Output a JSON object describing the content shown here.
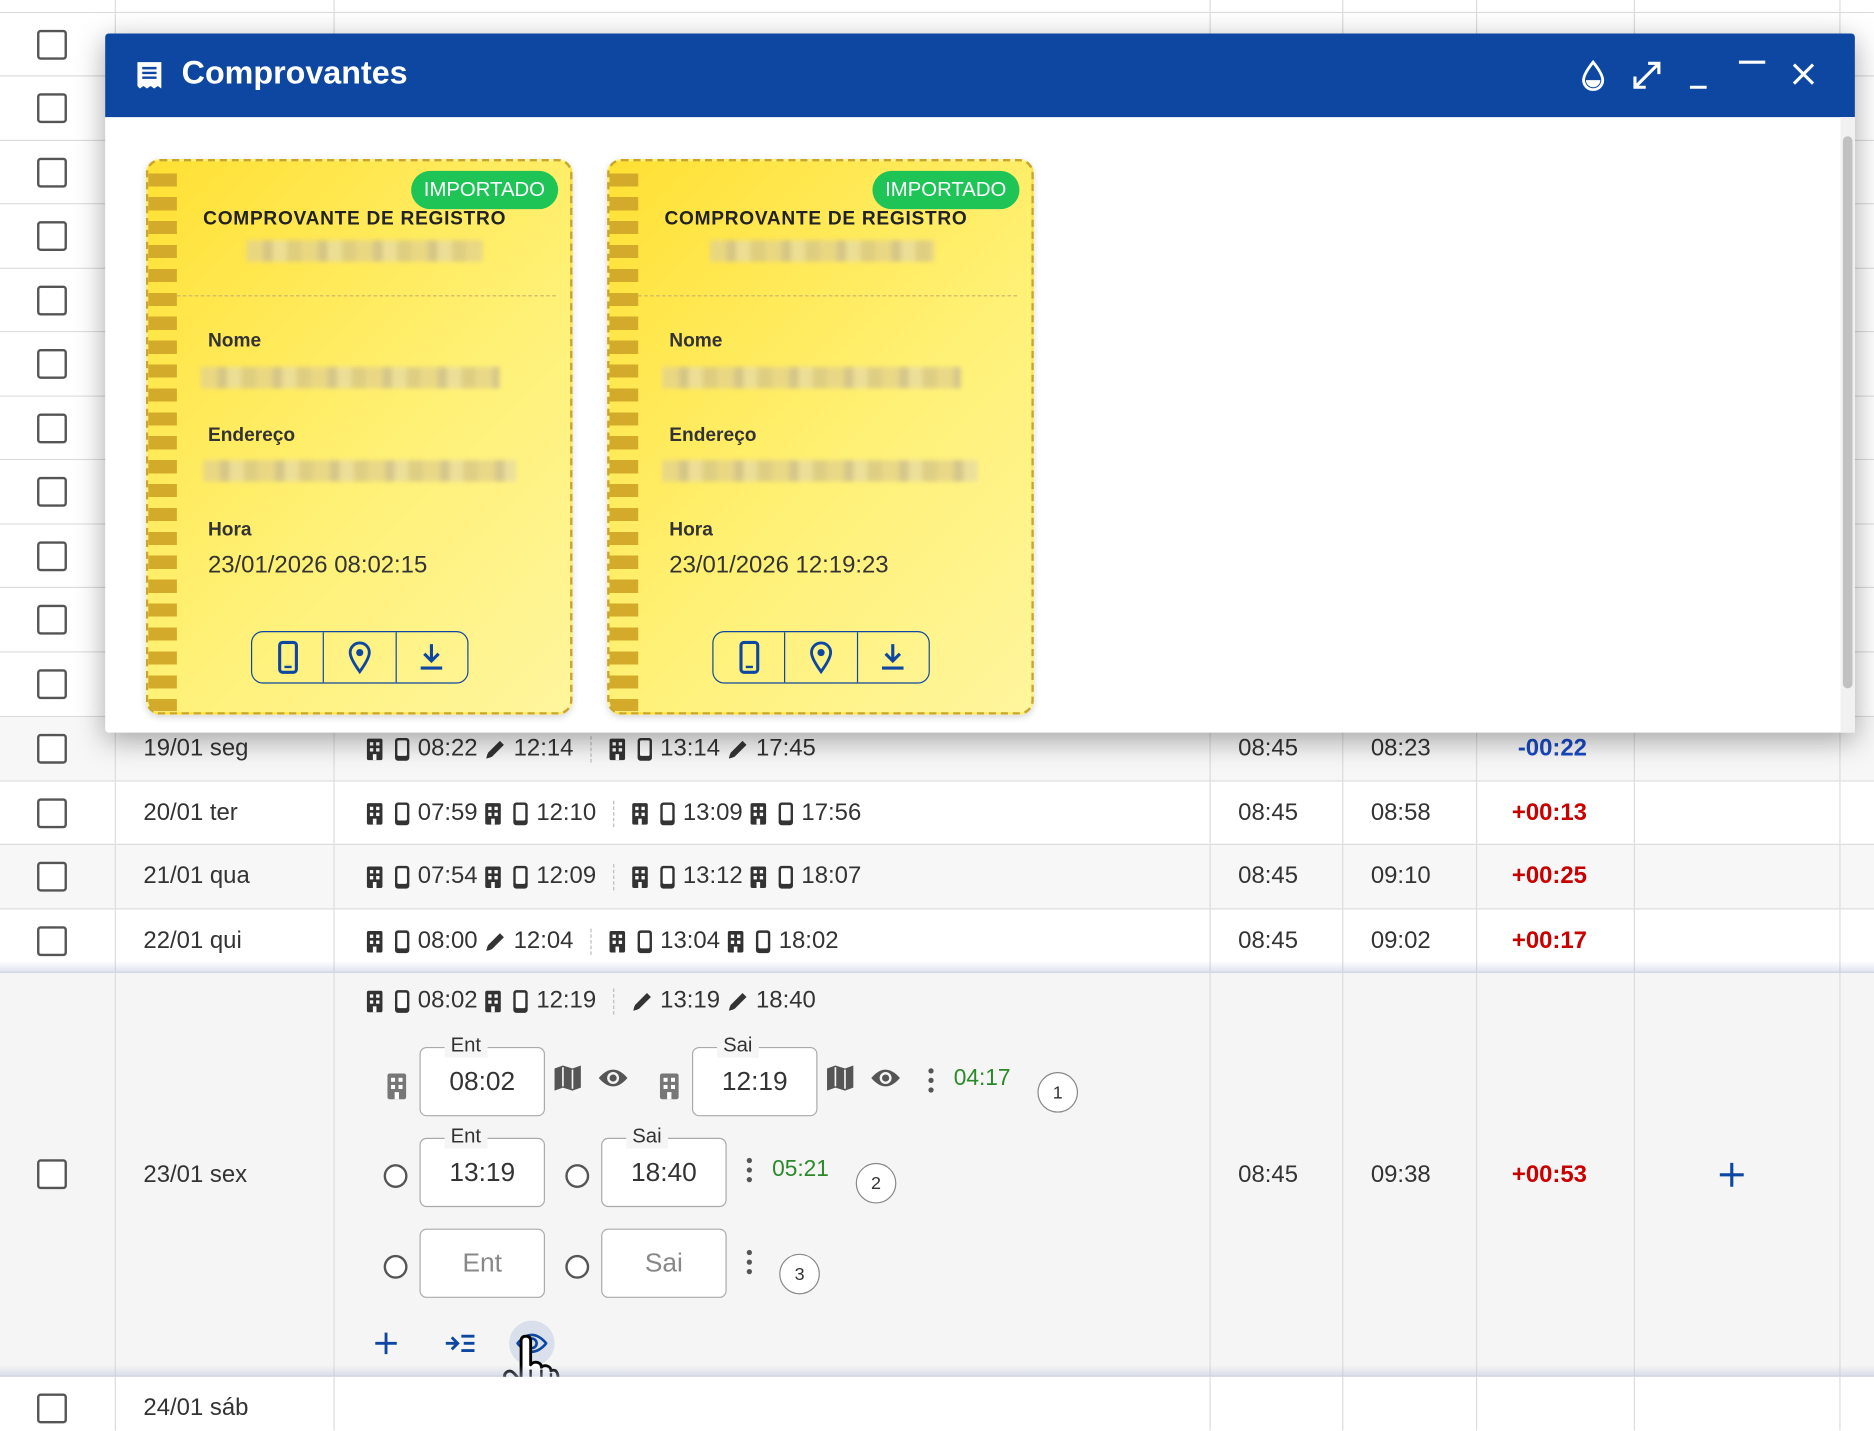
{
  "modal": {
    "title": "Comprovantes",
    "receipts": [
      {
        "badge": "IMPORTADO",
        "heading": "COMPROVANTE DE REGISTRO",
        "name_label": "Nome",
        "address_label": "Endereço",
        "hour_label": "Hora",
        "hour_value": "23/01/2026 08:02:15"
      },
      {
        "badge": "IMPORTADO",
        "heading": "COMPROVANTE DE REGISTRO",
        "name_label": "Nome",
        "address_label": "Endereço",
        "hour_label": "Hora",
        "hour_value": "23/01/2026 12:19:23"
      }
    ]
  },
  "rows": [
    {
      "date": "19/01 seg",
      "punches": [
        "08:22",
        "12:14",
        "13:14",
        "17:45"
      ],
      "expected": "08:45",
      "worked": "08:23",
      "balance": "-00:22"
    },
    {
      "date": "20/01 ter",
      "punches": [
        "07:59",
        "12:10",
        "13:09",
        "17:56"
      ],
      "expected": "08:45",
      "worked": "08:58",
      "balance": "+00:13"
    },
    {
      "date": "21/01 qua",
      "punches": [
        "07:54",
        "12:09",
        "13:12",
        "18:07"
      ],
      "expected": "08:45",
      "worked": "09:10",
      "balance": "+00:25"
    },
    {
      "date": "22/01 qui",
      "punches": [
        "08:00",
        "12:04",
        "13:04",
        "18:02"
      ],
      "expected": "08:45",
      "worked": "09:02",
      "balance": "+00:17"
    }
  ],
  "expanded": {
    "date": "23/01 sex",
    "punches": [
      "08:02",
      "12:19",
      "13:19",
      "18:40"
    ],
    "pair1": {
      "ent_label": "Ent",
      "ent": "08:02",
      "sai_label": "Sai",
      "sai": "12:19",
      "duration": "04:17",
      "index": "1"
    },
    "pair2": {
      "ent_label": "Ent",
      "ent": "13:19",
      "sai_label": "Sai",
      "sai": "18:40",
      "duration": "05:21",
      "index": "2"
    },
    "pair3": {
      "ent_placeholder": "Ent",
      "sai_placeholder": "Sai",
      "index": "3"
    },
    "expected": "08:45",
    "worked": "09:38",
    "balance": "+00:53"
  },
  "last_row": {
    "date": "24/01 sáb"
  },
  "icons": {
    "header": "receipt-icon",
    "drop": "drop-icon",
    "expand": "expand-icon",
    "minimize": "minimize-icon",
    "maximize": "maximize-icon",
    "close": "close-icon",
    "phone": "phone-icon",
    "pin": "location-pin-icon",
    "download": "download-icon",
    "building": "building-icon",
    "pencil": "pencil-icon",
    "map": "map-icon",
    "eye": "eye-icon",
    "more": "more-vert-icon",
    "plus": "plus-icon",
    "indent": "indent-icon",
    "cursor": "hand-cursor-icon"
  },
  "colors": {
    "header": "#0d47a1",
    "badge": "#1fc457",
    "negative": "#1a48c0",
    "positive": "#c80000",
    "duration": "#2a8a2a",
    "ticket": "#ffe033"
  }
}
